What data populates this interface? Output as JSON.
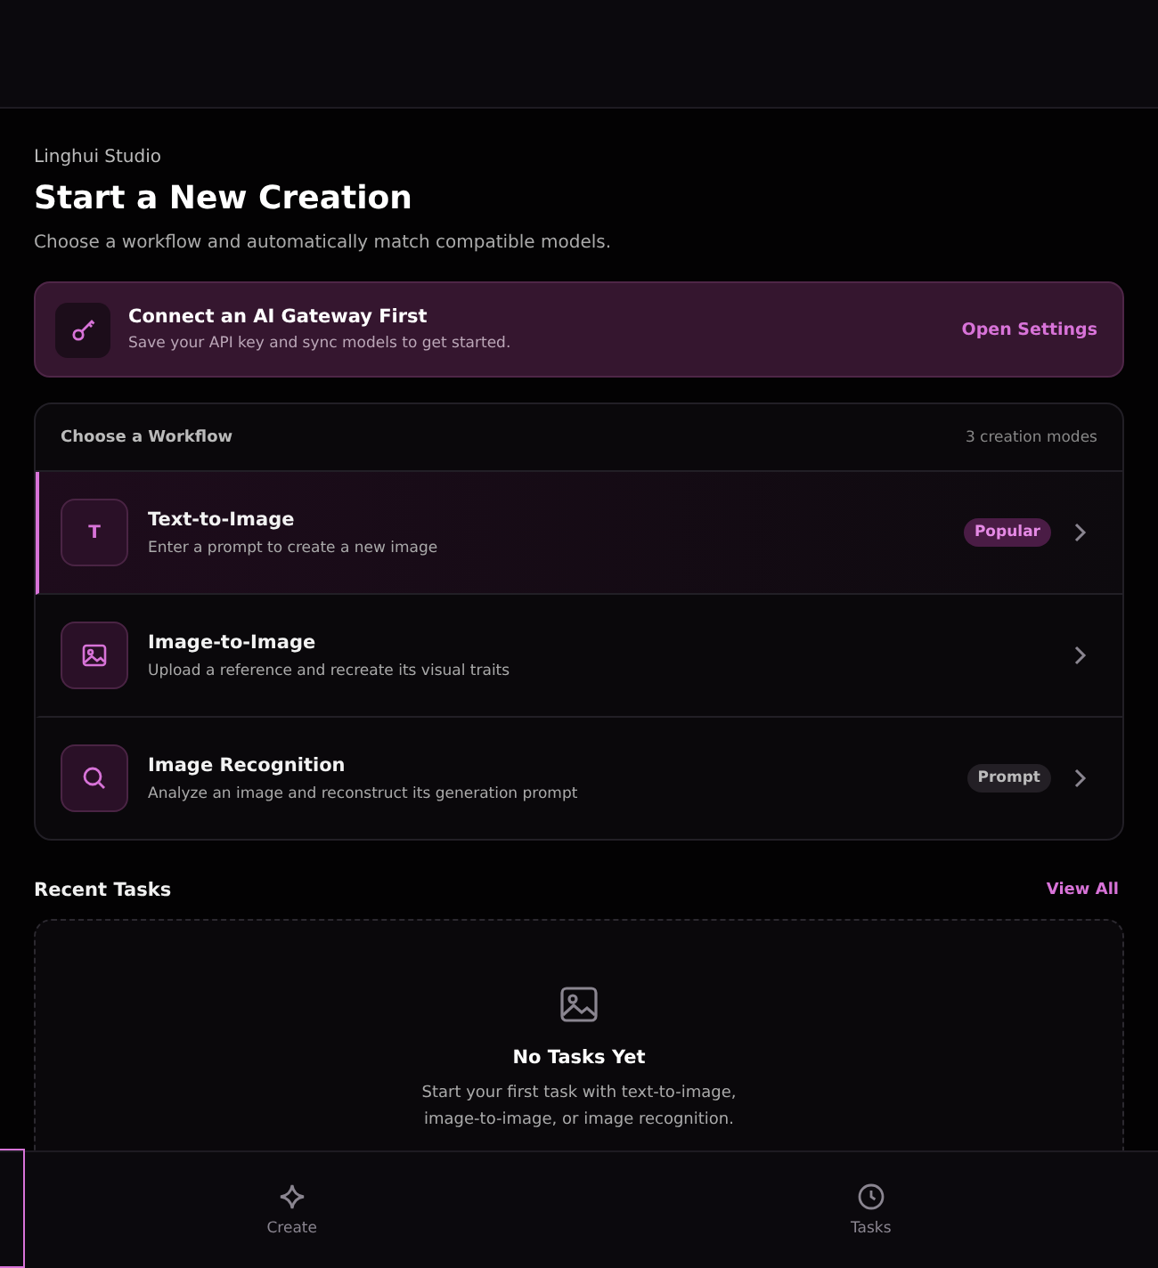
{
  "brand": "Linghui Studio",
  "title": "Start a New Creation",
  "subtitle": "Choose a workflow and automatically match compatible models.",
  "gateway": {
    "title": "Connect an AI Gateway First",
    "text": "Save your API key and sync models to get started.",
    "action": "Open Settings"
  },
  "workflows": {
    "heading": "Choose a Workflow",
    "count": "3 creation modes",
    "items": [
      {
        "kind": "text",
        "icon_text": "T",
        "title": "Text-to-Image",
        "text": "Enter a prompt to create a new image",
        "selected": true,
        "badge": {
          "label": "Popular",
          "kind": "accent"
        }
      },
      {
        "kind": "image",
        "title": "Image-to-Image",
        "text": "Upload a reference and recreate its visual traits",
        "selected": false
      },
      {
        "kind": "search",
        "title": "Image Recognition",
        "text": "Analyze an image and reconstruct its generation prompt",
        "selected": false,
        "badge": {
          "label": "Prompt",
          "kind": "neutral"
        }
      }
    ]
  },
  "recent": {
    "heading": "Recent Tasks",
    "action": "View All",
    "empty_title": "No Tasks Yet",
    "empty_text": "Start your first task with text-to-image, image-to-image, or image recognition."
  },
  "nav": [
    {
      "kind": "create",
      "label": "Create",
      "selected": false
    },
    {
      "kind": "tasks",
      "label": "Tasks",
      "selected": false
    }
  ]
}
